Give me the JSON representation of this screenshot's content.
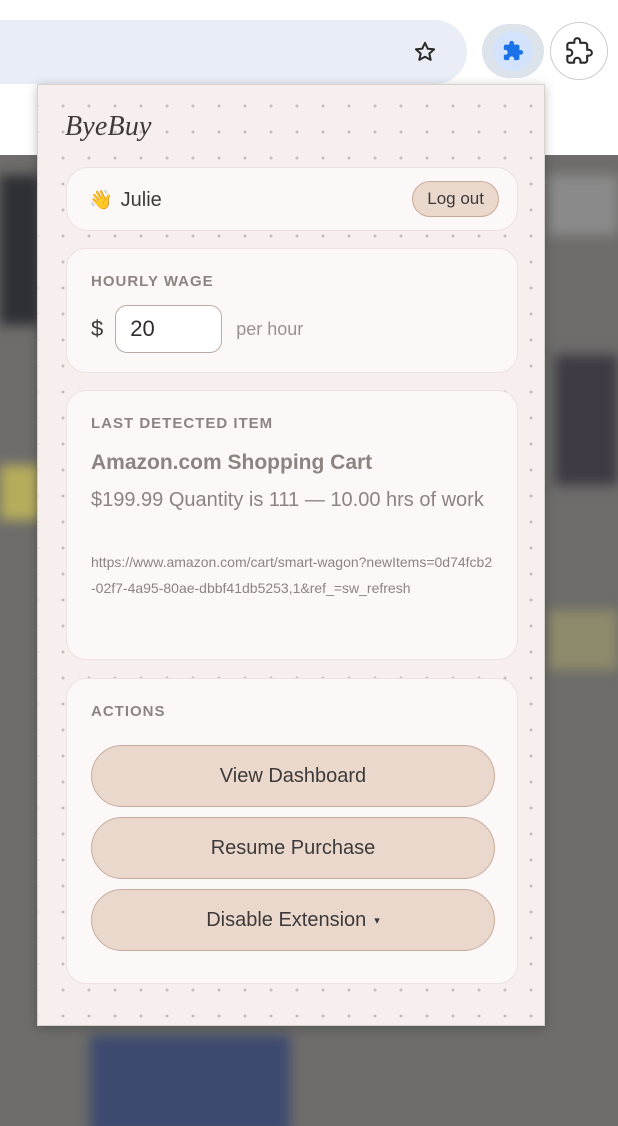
{
  "browser": {
    "star_icon": "star-icon",
    "extension_icon": "puzzle-icon",
    "extensions_menu_icon": "extensions-menu-icon"
  },
  "popup": {
    "brand": "ByeBuy",
    "user": {
      "emoji": "👋",
      "name": "Julie",
      "logout_label": "Log out"
    },
    "wage": {
      "label": "HOURLY WAGE",
      "currency": "$",
      "value": "20",
      "unit": "per hour"
    },
    "item": {
      "label": "LAST DETECTED ITEM",
      "title": "Amazon.com Shopping Cart",
      "description": "$199.99 Quantity is 111 — 10.00 hrs of work",
      "url": "https://www.amazon.com/cart/smart-wagon?newItems=0d74fcb2-02f7-4a95-80ae-dbbf41db5253,1&ref_=sw_refresh"
    },
    "actions": {
      "label": "ACTIONS",
      "view_dashboard": "View Dashboard",
      "resume_purchase": "Resume Purchase",
      "disable_extension": "Disable Extension",
      "disable_caret": "▾"
    }
  },
  "colors": {
    "popup_bg": "#f6efed",
    "card_bg": "#fcf8f7",
    "button_bg": "#ead8cd",
    "button_border": "#c8aa9c",
    "muted_text": "#8c8481",
    "extension_accent": "#1a73e8"
  }
}
